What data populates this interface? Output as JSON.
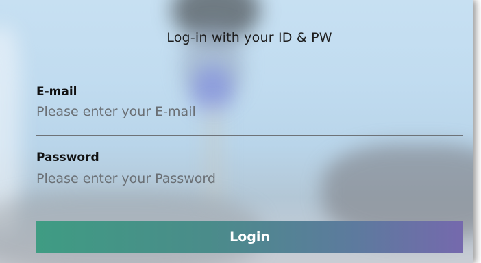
{
  "login_form": {
    "title": "Log-in with your ID & PW",
    "email": {
      "label": "E-mail",
      "placeholder": "Please enter your E-mail",
      "value": ""
    },
    "password": {
      "label": "Password",
      "placeholder": "Please enter your Password",
      "value": ""
    },
    "submit_label": "Login"
  },
  "colors": {
    "button_gradient_start": "#3f9c83",
    "button_gradient_end": "#7569ad",
    "underline": "#6e7378"
  }
}
